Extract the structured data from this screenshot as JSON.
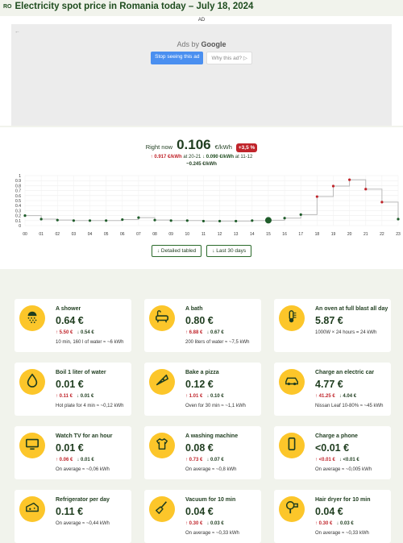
{
  "header": {
    "flag": "RO",
    "title": "Electricity spot price in Romania today – July 18, 2024"
  },
  "ad": {
    "label": "AD",
    "ads_by_prefix": "Ads by",
    "ads_by_brand": "Google",
    "stop_button": "Stop seeing this ad",
    "why_button": "Why this ad? ▷"
  },
  "now": {
    "label": "Right now",
    "value": "0.106",
    "unit": "€/kWh",
    "change": "+3,5 %",
    "max": "0.917 €/kWh",
    "max_at": "at 20-21",
    "min": "0.090 €/kWh",
    "min_at": "at 11-12",
    "avg": "~0.245 €/kWh"
  },
  "chart_data": {
    "type": "line",
    "x": [
      "00",
      "01",
      "02",
      "03",
      "04",
      "05",
      "06",
      "07",
      "08",
      "09",
      "10",
      "11",
      "12",
      "13",
      "14",
      "15",
      "16",
      "17",
      "18",
      "19",
      "20",
      "21",
      "22",
      "23"
    ],
    "y_ticks": [
      "0",
      "0.1",
      "0.2",
      "0.3",
      "0.4",
      "0.5",
      "0.6",
      "0.7",
      "0.8",
      "0.9",
      "1"
    ],
    "ylim": [
      0,
      1
    ],
    "values": [
      0.2,
      0.13,
      0.11,
      0.1,
      0.1,
      0.1,
      0.12,
      0.16,
      0.11,
      0.1,
      0.1,
      0.09,
      0.09,
      0.09,
      0.1,
      0.106,
      0.15,
      0.22,
      0.58,
      0.79,
      0.917,
      0.73,
      0.47,
      0.13
    ],
    "current_hour": 15,
    "colors": {
      "low": "#1f5c2a",
      "high": "#c0252b",
      "step_line": "#bbbbbb"
    }
  },
  "chart_buttons": {
    "detailed": "↓ Detailed tabled",
    "last30": "↓ Last 30 days"
  },
  "cards": [
    {
      "icon": "shower-icon",
      "title": "A shower",
      "price": "0.64 €",
      "max": "↑ 5.50 €",
      "min": "↓ 0.54 €",
      "note": "10 min, 160 l of water ≈ ~6 kWh"
    },
    {
      "icon": "bath-icon",
      "title": "A bath",
      "price": "0.80 €",
      "max": "↑ 6.88 €",
      "min": "↓ 0.67 €",
      "note": "200 liters of water ≈ ~7,5 kWh"
    },
    {
      "icon": "oven-icon",
      "title": "An oven at full blast all day",
      "price": "5.87 €",
      "max": "",
      "min": "",
      "note": "1000W × 24 hours = 24 kWh"
    },
    {
      "icon": "water-drop-icon",
      "title": "Boil 1 liter of water",
      "price": "0.01 €",
      "max": "↑ 0.11 €",
      "min": "↓ 0.01 €",
      "note": "Hot plate for 4 min ≈ ~0,12 kWh"
    },
    {
      "icon": "pizza-icon",
      "title": "Bake a pizza",
      "price": "0.12 €",
      "max": "↑ 1.01 €",
      "min": "↓ 0.10 €",
      "note": "Oven for 30 min ≈ ~1,1 kWh"
    },
    {
      "icon": "car-icon",
      "title": "Charge an electric car",
      "price": "4.77 €",
      "max": "↑ 41.25 €",
      "min": "↓ 4.04 €",
      "note": "Nissan Leaf 10-80% ≈ ~45 kWh"
    },
    {
      "icon": "tv-icon",
      "title": "Watch TV for an hour",
      "price": "0.01 €",
      "max": "↑ 0.06 €",
      "min": "↓ 0.01 €",
      "note": "On average ≈ ~0,06 kWh"
    },
    {
      "icon": "shirt-icon",
      "title": "A washing machine",
      "price": "0.08 €",
      "max": "↑ 0.73 €",
      "min": "↓ 0.07 €",
      "note": "On average ≈ ~0,8 kWh"
    },
    {
      "icon": "phone-icon",
      "title": "Charge a phone",
      "price": "<0.01 €",
      "max": "↑ <0.01 €",
      "min": "↓ <0.01 €",
      "note": "On average ≈ ~0,005 kWh"
    },
    {
      "icon": "cheese-icon",
      "title": "Refrigerator per day",
      "price": "0.11 €",
      "max": "",
      "min": "",
      "note": "On average ≈ ~0,44 kWh"
    },
    {
      "icon": "broom-icon",
      "title": "Vacuum for 10 min",
      "price": "0.04 €",
      "max": "↑ 0.30 €",
      "min": "↓ 0.03 €",
      "note": "On average ≈ ~0,33 kWh"
    },
    {
      "icon": "hair-dryer-icon",
      "title": "Hair dryer for 10 min",
      "price": "0.04 €",
      "max": "↑ 0.30 €",
      "min": "↓ 0.03 €",
      "note": "On average ≈ ~0,33 kWh"
    }
  ]
}
